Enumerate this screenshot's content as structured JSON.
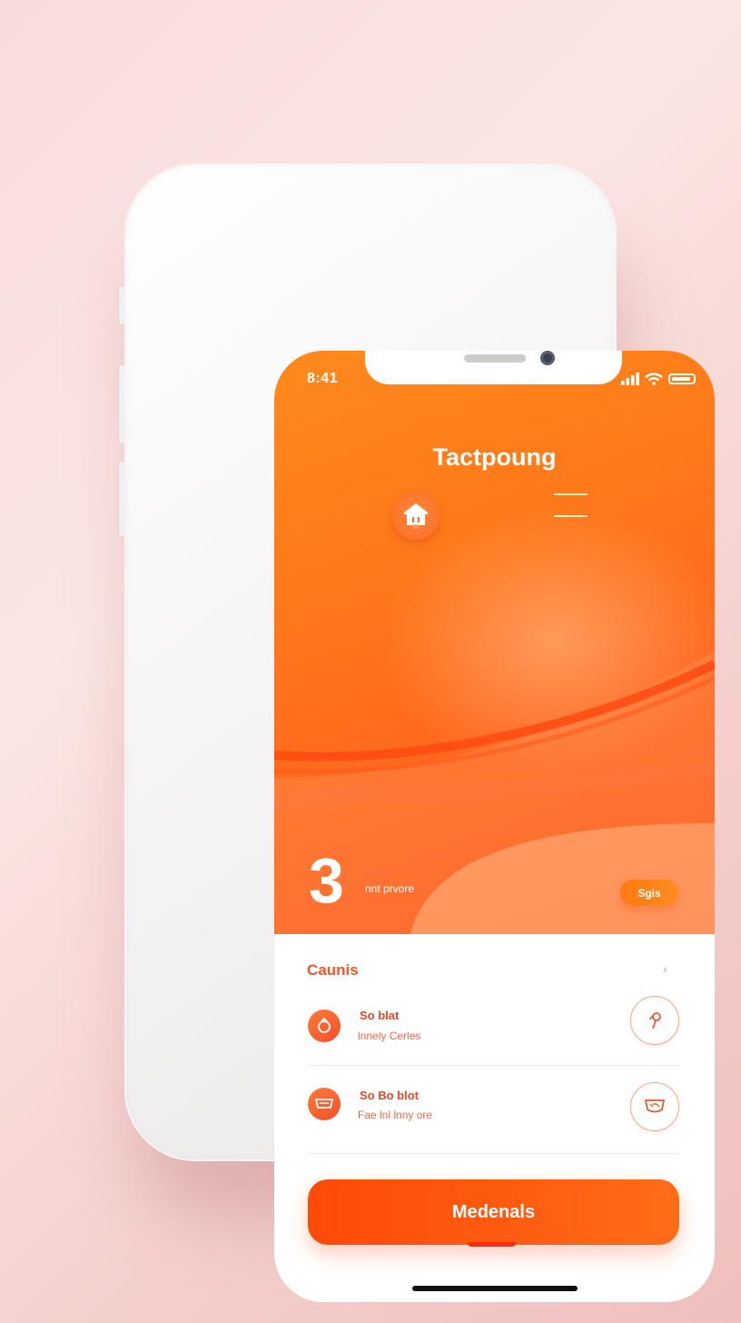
{
  "status_bar": {
    "time": "8:41"
  },
  "header": {
    "title": "Tactpoung"
  },
  "hero": {
    "big_number": "3",
    "caption": "nnt prvore",
    "pill_label": "Sgis"
  },
  "section": {
    "title": "Caunis",
    "chevron": "›"
  },
  "list": [
    {
      "title": "So blat",
      "subtitle": "lnnely Cerles"
    },
    {
      "title": "So Bo blot",
      "subtitle": "Fae lnl lnny ore"
    }
  ],
  "primary_button": {
    "label": "Medenals"
  },
  "colors": {
    "accent": "#ff5a14",
    "accent_text": "#f0562a",
    "background": "#f8dcdc"
  },
  "icons": {
    "home": "home-icon",
    "menu": "menu-icon",
    "row_1": "bell-icon",
    "row_1_action": "pin-icon",
    "row_2": "message-icon",
    "row_2_action": "chat-icon"
  }
}
